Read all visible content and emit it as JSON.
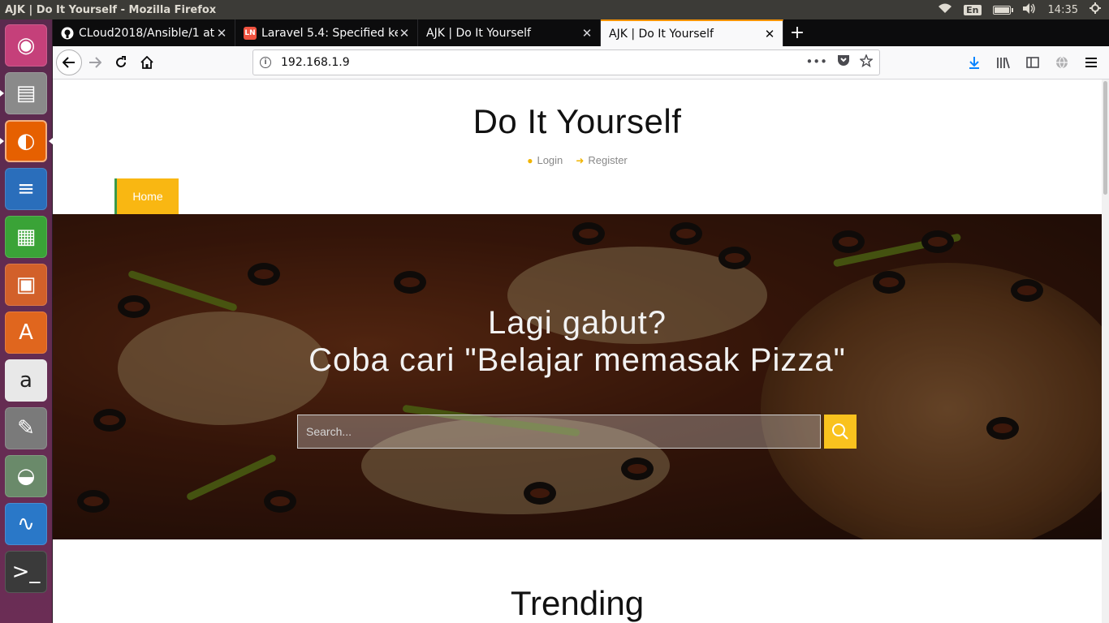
{
  "os": {
    "window_title": "AJK | Do It Yourself - Mozilla Firefox",
    "keyboard_layout": "En",
    "clock": "14:35",
    "battery_level": 0.9
  },
  "launcher": {
    "apps": [
      {
        "name": "ubuntu-dash",
        "icon": "ubuntu-logo-icon",
        "color": "#c5407a"
      },
      {
        "name": "files",
        "icon": "file-cabinet-icon",
        "color": "#8a8a8a"
      },
      {
        "name": "firefox",
        "icon": "firefox-icon",
        "color": "#e66000"
      },
      {
        "name": "libreoffice-writer",
        "icon": "writer-icon",
        "color": "#2a6ebb"
      },
      {
        "name": "libreoffice-calc",
        "icon": "calc-icon",
        "color": "#3aa337"
      },
      {
        "name": "libreoffice-impress",
        "icon": "impress-icon",
        "color": "#d2602a"
      },
      {
        "name": "ubuntu-software",
        "icon": "software-bag-icon",
        "color": "#e0661e"
      },
      {
        "name": "amazon",
        "icon": "amazon-icon",
        "color": "#e8e8e8"
      },
      {
        "name": "system-settings",
        "icon": "settings-wrench-icon",
        "color": "#7a7a7a"
      },
      {
        "name": "disk-usage",
        "icon": "disk-icon",
        "color": "#6a8a6a"
      },
      {
        "name": "system-monitor",
        "icon": "monitor-graph-icon",
        "color": "#2a78c8"
      },
      {
        "name": "terminal",
        "icon": "terminal-icon",
        "color": "#3a3a3a"
      }
    ]
  },
  "browser": {
    "tabs": [
      {
        "label": "CLoud2018/Ansible/1 at",
        "favicon": "github-icon",
        "favicon_color": "#ffffff"
      },
      {
        "label": "Laravel 5.4: Specified ke",
        "favicon": "laravel-news-icon",
        "favicon_color": "#f05340"
      },
      {
        "label": "AJK | Do It Yourself",
        "favicon": "",
        "favicon_color": ""
      },
      {
        "label": "AJK | Do It Yourself",
        "favicon": "",
        "favicon_color": ""
      }
    ],
    "url": "192.168.1.9",
    "accent_color": "#ff9400"
  },
  "site": {
    "title": "Do It Yourself",
    "login": "Login",
    "register": "Register",
    "nav_home": "Home",
    "hero_line1": "Lagi gabut?",
    "hero_line2": "Coba cari \"Belajar memasak Pizza\"",
    "search_placeholder": "Search...",
    "trending": "Trending",
    "brand_yellow": "#f9b712"
  }
}
